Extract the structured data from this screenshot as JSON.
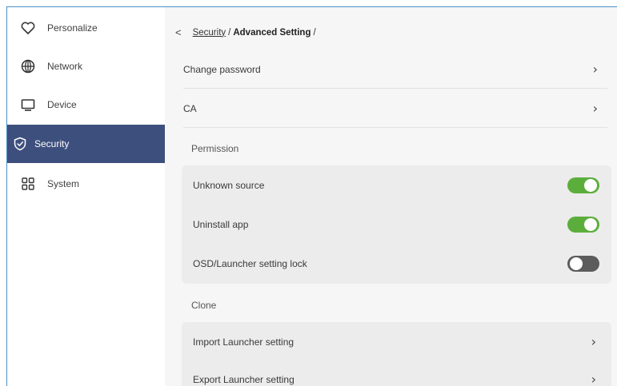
{
  "sidebar": {
    "items": [
      {
        "label": "Personalize",
        "icon": "heart-icon"
      },
      {
        "label": "Network",
        "icon": "globe-icon"
      },
      {
        "label": "Device",
        "icon": "monitor-icon"
      },
      {
        "label": "Security",
        "icon": "shield-check-icon",
        "active": true
      },
      {
        "label": "System",
        "icon": "grid-icon"
      }
    ],
    "active_color": "#3d4f7d"
  },
  "breadcrumb": {
    "back": "<",
    "parent": "Security",
    "separator": "/",
    "current": "Advanced Setting",
    "trailing": "/"
  },
  "rows": {
    "change_password": "Change password",
    "ca": "CA"
  },
  "permission": {
    "label": "Permission",
    "items": [
      {
        "label": "Unknown source",
        "state": "on"
      },
      {
        "label": "Uninstall app",
        "state": "on"
      },
      {
        "label": "OSD/Launcher setting lock",
        "state": "off"
      }
    ]
  },
  "clone": {
    "label": "Clone",
    "items": [
      {
        "label": "Import Launcher setting"
      },
      {
        "label": "Export Launcher setting"
      }
    ]
  },
  "colors": {
    "toggle_on": "#5cae3c",
    "toggle_off": "#5c5c5c",
    "frame_border": "#4a90c8"
  }
}
